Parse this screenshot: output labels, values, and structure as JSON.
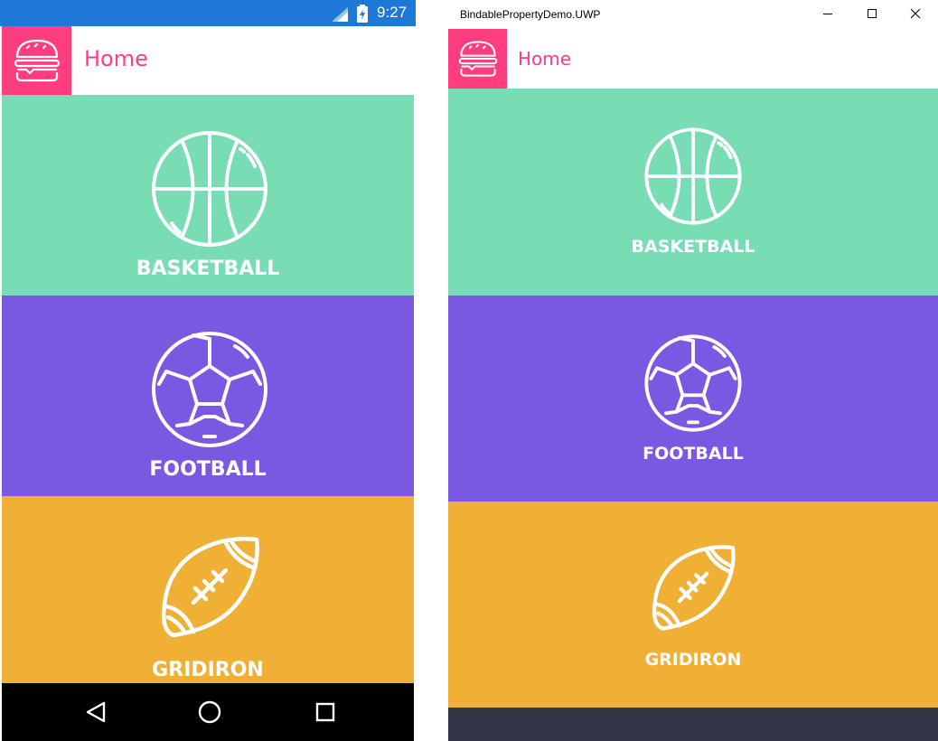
{
  "colors": {
    "accent": "#ff3d7f",
    "basketball": "#78dcb5",
    "football": "#7b58e2",
    "gridiron": "#f0b036",
    "android_status_bar": "#1e78d8",
    "android_nav_bar": "#000000",
    "uwp_bottom_bar": "#343447"
  },
  "android": {
    "status_bar": {
      "time": "9:27",
      "icons": [
        "signal-icon",
        "battery-icon"
      ]
    },
    "app_bar": {
      "menu_icon": "burger-icon",
      "title": "Home"
    },
    "tiles": [
      {
        "icon": "basketball-icon",
        "label": "BASKETBALL"
      },
      {
        "icon": "football-icon",
        "label": "FOOTBALL"
      },
      {
        "icon": "gridiron-icon",
        "label": "GRIDIRON"
      }
    ],
    "nav_bar": {
      "buttons": [
        "back-icon",
        "home-icon",
        "recents-icon"
      ]
    }
  },
  "uwp": {
    "window_title": "BindablePropertyDemo.UWP",
    "window_controls": [
      "minimize-icon",
      "maximize-icon",
      "close-icon"
    ],
    "app_bar": {
      "menu_icon": "burger-icon",
      "title": "Home"
    },
    "tiles": [
      {
        "icon": "basketball-icon",
        "label": "BASKETBALL"
      },
      {
        "icon": "football-icon",
        "label": "FOOTBALL"
      },
      {
        "icon": "gridiron-icon",
        "label": "GRIDIRON"
      }
    ]
  }
}
